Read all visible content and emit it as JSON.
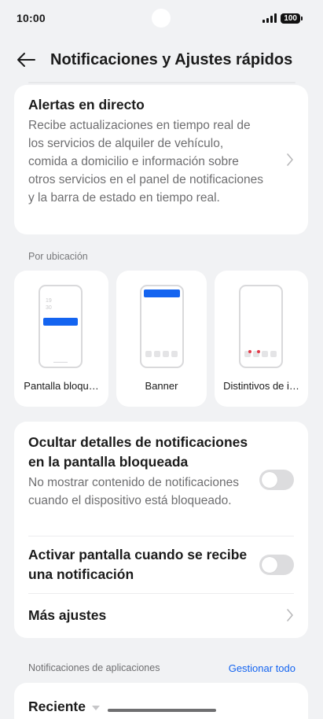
{
  "status": {
    "time": "10:00",
    "battery": "100"
  },
  "header": {
    "title": "Notificaciones y Ajustes rápidos"
  },
  "alerts": {
    "title": "Alertas en directo",
    "description": "Recibe actualizaciones en tiempo real de los servicios de alquiler de vehículo, comida a domicilio e información sobre otros servicios en el panel de notificaciones y la barra de estado en tiempo real."
  },
  "positions": {
    "section_label": "Por ubicación",
    "items": [
      {
        "label": "Pantalla bloqu…",
        "clock_h": "19",
        "clock_m": "30"
      },
      {
        "label": "Banner"
      },
      {
        "label": "Distintivos de i…"
      }
    ]
  },
  "settings": {
    "hide_details_title": "Ocultar detalles de notificaciones en la pantalla bloqueada",
    "hide_details_desc": "No mostrar contenido de notificaciones cuando el dispositivo está bloqueado.",
    "hide_details_enabled": false,
    "wake_screen_title": "Activar pantalla cuando se recibe una notificación",
    "wake_screen_enabled": false,
    "more_settings": "Más ajustes"
  },
  "apps": {
    "section_label": "Notificaciones de aplicaciones",
    "manage_all": "Gestionar todo",
    "sort_label": "Reciente"
  },
  "colors": {
    "accent": "#1464f0",
    "background": "#f1f2f4",
    "badge": "#e23b4a"
  }
}
